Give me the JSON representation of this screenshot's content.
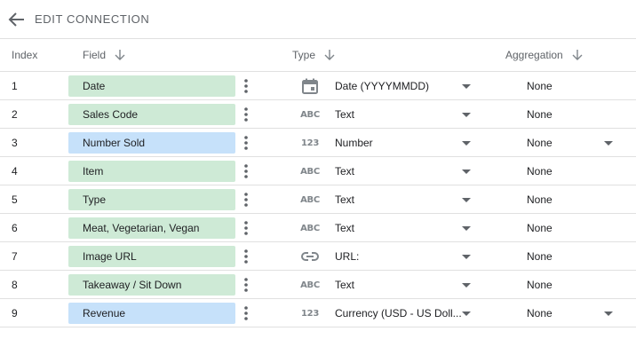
{
  "header": {
    "title": "EDIT CONNECTION",
    "back_icon": "arrow-left-icon"
  },
  "columns": {
    "index": "Index",
    "field": "Field",
    "type": "Type",
    "aggregation": "Aggregation",
    "sort_icon": "arrow-down-icon"
  },
  "colors": {
    "dimension_pill": "#ceead6",
    "metric_pill": "#c6e1fa",
    "icon_gray": "#80868b",
    "divider": "#e0e0e0"
  },
  "rows": [
    {
      "index": "1",
      "field": "Date",
      "kind": "dimension",
      "type_icon": "calendar-icon",
      "type": "Date (YYYYMMDD)",
      "aggregation": "None",
      "agg_dropdown": false
    },
    {
      "index": "2",
      "field": "Sales Code",
      "kind": "dimension",
      "type_icon": "text-abc-icon",
      "type": "Text",
      "aggregation": "None",
      "agg_dropdown": false
    },
    {
      "index": "3",
      "field": "Number Sold",
      "kind": "metric",
      "type_icon": "number-123-icon",
      "type": "Number",
      "aggregation": "None",
      "agg_dropdown": true
    },
    {
      "index": "4",
      "field": "Item",
      "kind": "dimension",
      "type_icon": "text-abc-icon",
      "type": "Text",
      "aggregation": "None",
      "agg_dropdown": false
    },
    {
      "index": "5",
      "field": "Type",
      "kind": "dimension",
      "type_icon": "text-abc-icon",
      "type": "Text",
      "aggregation": "None",
      "agg_dropdown": false
    },
    {
      "index": "6",
      "field": "Meat, Vegetarian, Vegan",
      "kind": "dimension",
      "type_icon": "text-abc-icon",
      "type": "Text",
      "aggregation": "None",
      "agg_dropdown": false
    },
    {
      "index": "7",
      "field": "Image URL",
      "kind": "dimension",
      "type_icon": "link-icon",
      "type": "URL:",
      "aggregation": "None",
      "agg_dropdown": false
    },
    {
      "index": "8",
      "field": "Takeaway / Sit Down",
      "kind": "dimension",
      "type_icon": "text-abc-icon",
      "type": "Text",
      "aggregation": "None",
      "agg_dropdown": false
    },
    {
      "index": "9",
      "field": "Revenue",
      "kind": "metric",
      "type_icon": "number-123-icon",
      "type": "Currency (USD - US Doll...",
      "aggregation": "None",
      "agg_dropdown": true
    }
  ]
}
